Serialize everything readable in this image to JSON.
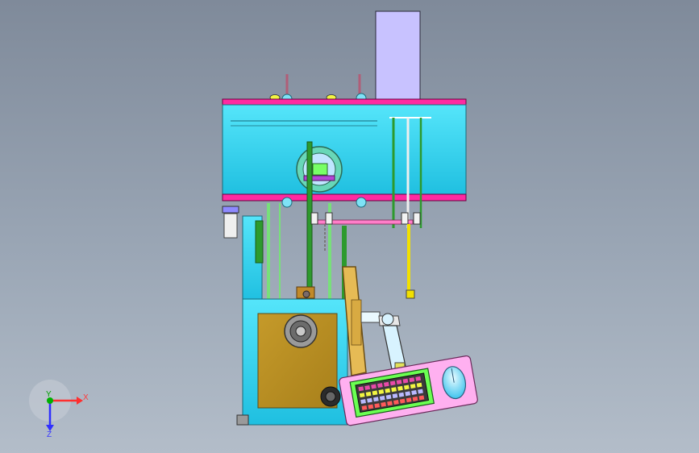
{
  "viewer": {
    "triad": {
      "x_label": "X",
      "y_label": "Y",
      "z_label": "Z"
    }
  },
  "colors": {
    "background_top": "#7f8a9a",
    "background_bottom": "#b3bdc9",
    "frame_cyan": "#39d7f0",
    "rail_magenta": "#ff2aa1",
    "tower_lavender": "#c8c2ff",
    "panel_gold": "#c69c2b",
    "keyboard_pink": "#ff9de9",
    "keyboard_green": "#6bff52",
    "rod_green": "#2d9a2d",
    "pink_bar": "#ff7ec9"
  }
}
